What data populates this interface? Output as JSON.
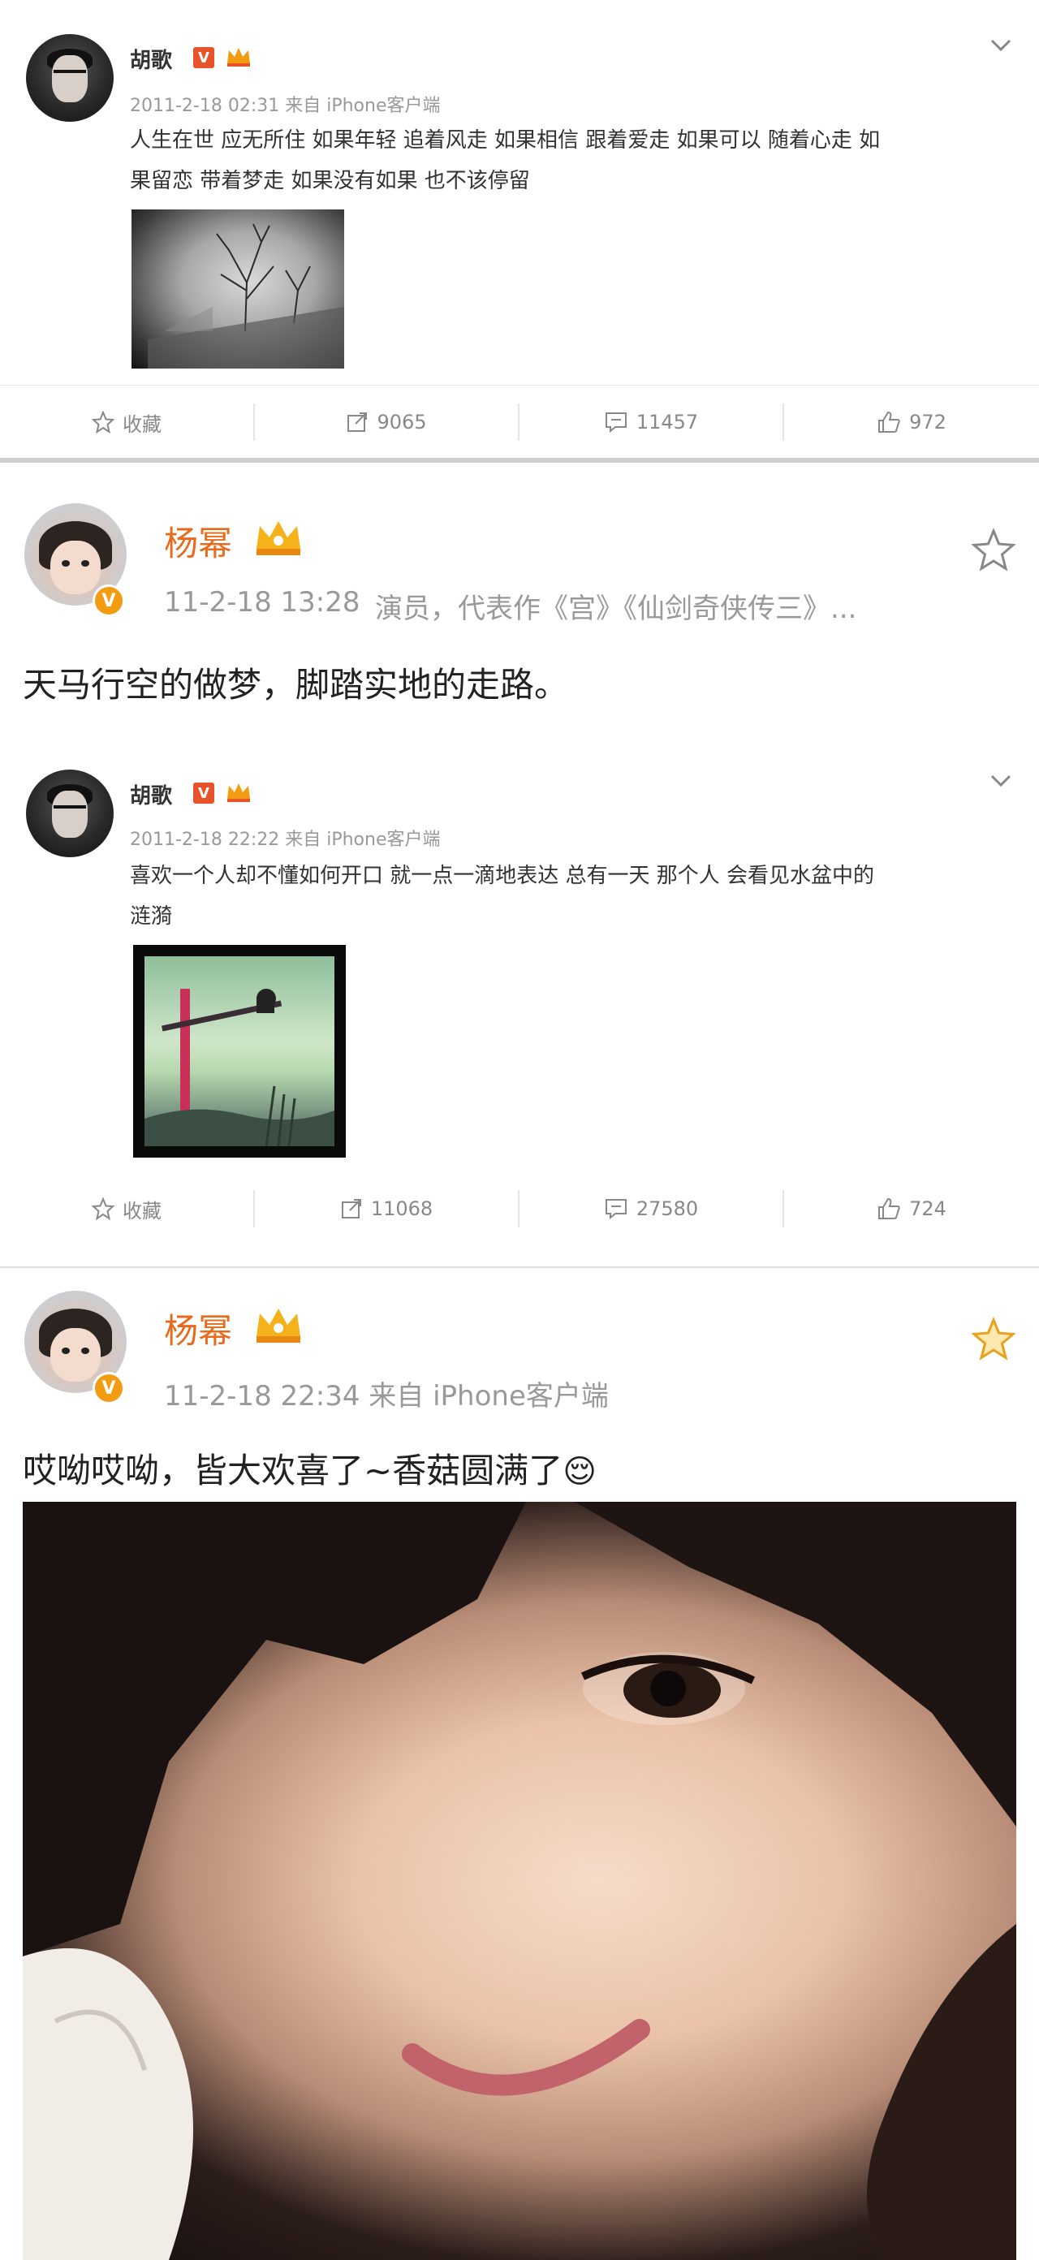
{
  "posts": [
    {
      "author": "胡歌",
      "verified_badge": "V",
      "time_source": "2011-2-18 02:31 来自 iPhone客户端",
      "text_line1": "人生在世 应无所住 如果年轻 追着风走 如果相信 跟着爱走 如果可以 随着心走 如",
      "text_line2": "果留恋 带着梦走 如果没有如果 也不该停留",
      "image": "tree-photo",
      "actions": {
        "favorite": "收藏",
        "repost": "9065",
        "comment": "11457",
        "like": "972"
      }
    },
    {
      "author": "杨幂",
      "verified_badge": "V",
      "time": "11-2-18 13:28",
      "bio": "演员，代表作《宫》《仙剑奇侠传三》...",
      "text": "天马行空的做梦，脚踏实地的走路。",
      "star": "outline"
    },
    {
      "author": "胡歌",
      "verified_badge": "V",
      "time_source": "2011-2-18 22:22 来自 iPhone客户端",
      "text_line1": "喜欢一个人却不懂如何开口 就一点一滴地表达 总有一天 那个人 会看见水盆中的",
      "text_line2": "涟漪",
      "image": "pole-photo",
      "actions": {
        "favorite": "收藏",
        "repost": "11068",
        "comment": "27580",
        "like": "724"
      }
    },
    {
      "author": "杨幂",
      "verified_badge": "V",
      "time_source": "11-2-18 22:34 来自 iPhone客户端",
      "text": "哎呦哎呦，皆大欢喜了~香菇圆满了",
      "emoji": "😌",
      "star": "filled",
      "image": "selfie-photo"
    }
  ],
  "colors": {
    "accent": "#e86b1c",
    "badge": "#f39c12",
    "muted": "#999999"
  }
}
